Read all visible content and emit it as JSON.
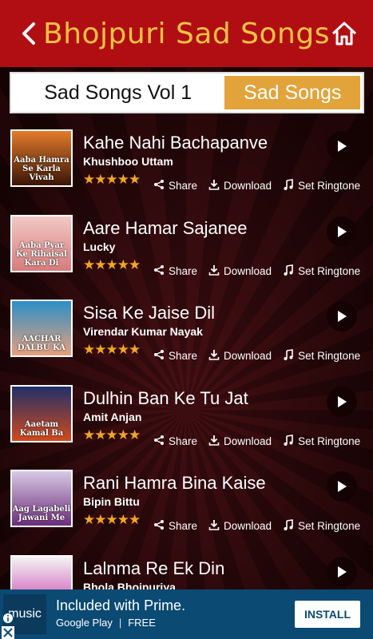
{
  "header": {
    "title": "Bhojpuri Sad Songs",
    "back_icon": "back-arrow-icon",
    "home_icon": "home-icon",
    "bg_color": "#b10e14",
    "title_color": "#f6c243"
  },
  "tabs": [
    {
      "label": "Sad Songs Vol 1",
      "selected": false
    },
    {
      "label": "Sad Songs",
      "selected": true
    }
  ],
  "actions": {
    "share": "Share",
    "download": "Download",
    "ringtone": "Set Ringtone"
  },
  "songs": [
    {
      "title": "Kahe Nahi Bachapanve",
      "artist": "Khushboo Uttam",
      "stars": "★★★★★",
      "thumb_text": "Aaba Hamra Se Karla Vivah",
      "thumb_bg": "linear-gradient(180deg,#e37b2a,#3a1508)"
    },
    {
      "title": "Aare Hamar Sajanee",
      "artist": "Lucky",
      "stars": "★★★★★",
      "thumb_text": "Aaba Pyar Ke Rihaisal Kara Di",
      "thumb_bg": "linear-gradient(180deg,#f1c9c5,#d77b7b)"
    },
    {
      "title": "Sisa Ke Jaise Dil",
      "artist": "Virendar Kumar Nayak",
      "stars": "★★★★★",
      "thumb_text": "AACHAR DALBU KA",
      "thumb_bg": "linear-gradient(180deg,#2b8fc8,#e7a07c)"
    },
    {
      "title": "Dulhin Ban Ke Tu Jat",
      "artist": "Amit Anjan",
      "stars": "★★★★★",
      "thumb_text": "Aaetam Kamal Ba",
      "thumb_bg": "linear-gradient(180deg,#20306a,#d04a1d)"
    },
    {
      "title": "Rani Hamra Bina Kaise",
      "artist": "Bipin Bittu",
      "stars": "★★★★★",
      "thumb_text": "Aag Lagabeli Jawani Me",
      "thumb_bg": "linear-gradient(180deg,#d7c9e6,#6c2d7a)"
    },
    {
      "title": "Lalnma Re Ek Din",
      "artist": "Bhola Bhojpuriya",
      "stars": "★★★★★",
      "thumb_text": "",
      "thumb_bg": "linear-gradient(180deg,#f4f4f4,#c83fae)"
    }
  ],
  "ad": {
    "logo_text": "music",
    "title": "Included with Prime.",
    "store": "Google Play",
    "price": "FREE",
    "install": "INSTALL",
    "bg_color": "#0a4a73"
  }
}
